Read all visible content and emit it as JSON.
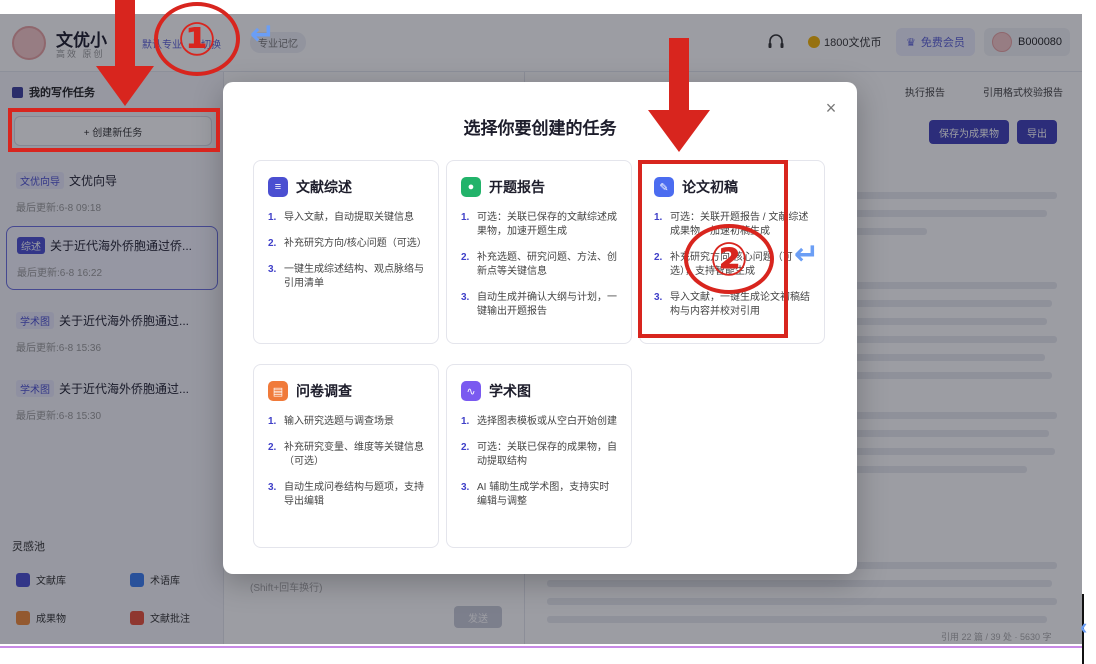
{
  "app": {
    "name": "文优小",
    "subtitle": "高效 原创",
    "default_spec": "默认专业",
    "switch_label": "切换",
    "memory_label": "专业记忆",
    "coins": "1800文优币",
    "vip_label": "免费会员",
    "user_id": "B000080"
  },
  "sidebar": {
    "title": "我的写作任务",
    "new_task": "+ 创建新任务",
    "tasks": [
      {
        "tag": "文优向导",
        "title": "文优向导",
        "time": "最后更新:6-8 09:18"
      },
      {
        "tag": "综述",
        "title": "关于近代海外侨胞通过侨...",
        "time": "最后更新:6-8 16:22"
      },
      {
        "tag": "学术图",
        "title": "关于近代海外侨胞通过...",
        "time": "最后更新:6-8 15:36"
      },
      {
        "tag": "学术图",
        "title": "关于近代海外侨胞通过...",
        "time": "最后更新:6-8 15:30"
      }
    ],
    "inspire": "灵感池",
    "tools": [
      "文献库",
      "术语库",
      "成果物",
      "文献批注"
    ]
  },
  "chat": {
    "hint": "(Shift+回车换行)",
    "send": "发送"
  },
  "editor": {
    "tabs": [
      "执行报告",
      "引用格式校验报告"
    ],
    "save": "保存为成果物",
    "export": "导出",
    "stats": "引用 22 篇 / 39 处 · 5630 字"
  },
  "modal": {
    "title": "选择你要创建的任务",
    "close": "×",
    "cards": [
      {
        "title": "文献综述",
        "color": "#4b4fd1",
        "icon": "≡",
        "steps": [
          "导入文献，自动提取关键信息",
          "补充研究方向/核心问题（可选）",
          "一键生成综述结构、观点脉络与引用清单"
        ]
      },
      {
        "title": "开题报告",
        "color": "#22b36a",
        "icon": "●",
        "steps": [
          "可选：关联已保存的文献综述成果物，加速开题生成",
          "补充选题、研究问题、方法、创新点等关键信息",
          "自动生成并确认大纲与计划，一键输出开题报告"
        ]
      },
      {
        "title": "论文初稿",
        "color": "#4b6cf0",
        "icon": "✎",
        "steps": [
          "可选：关联开题报告 / 文献综述成果物，加速初稿生成",
          "补充研究方向/核心问题（可选），支持智能生成",
          "导入文献，一键生成论文初稿结构与内容并校对引用"
        ]
      },
      {
        "title": "问卷调查",
        "color": "#f07a3a",
        "icon": "▤",
        "steps": [
          "输入研究选题与调查场景",
          "补充研究变量、维度等关键信息（可选）",
          "自动生成问卷结构与题项，支持导出编辑"
        ]
      },
      {
        "title": "学术图",
        "color": "#7a5af0",
        "icon": "∿",
        "steps": [
          "选择图表模板或从空白开始创建",
          "可选：关联已保存的成果物，自动提取结构",
          "AI 辅助生成学术图，支持实时编辑与调整"
        ]
      }
    ]
  },
  "annotations": {
    "circle1": "①",
    "circle2": "②"
  }
}
